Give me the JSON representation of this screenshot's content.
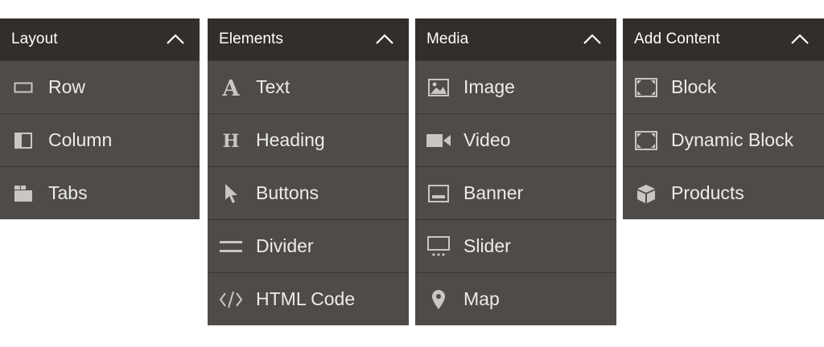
{
  "panels": {
    "layout": {
      "title": "Layout",
      "items": [
        {
          "label": "Row",
          "icon": "row-icon"
        },
        {
          "label": "Column",
          "icon": "column-icon"
        },
        {
          "label": "Tabs",
          "icon": "tabs-icon"
        }
      ]
    },
    "elements": {
      "title": "Elements",
      "items": [
        {
          "label": "Text",
          "icon": "text-icon"
        },
        {
          "label": "Heading",
          "icon": "heading-icon"
        },
        {
          "label": "Buttons",
          "icon": "pointer-icon"
        },
        {
          "label": "Divider",
          "icon": "divider-icon"
        },
        {
          "label": "HTML Code",
          "icon": "code-icon"
        }
      ]
    },
    "media": {
      "title": "Media",
      "items": [
        {
          "label": "Image",
          "icon": "image-icon"
        },
        {
          "label": "Video",
          "icon": "video-icon"
        },
        {
          "label": "Banner",
          "icon": "banner-icon"
        },
        {
          "label": "Slider",
          "icon": "slider-icon"
        },
        {
          "label": "Map",
          "icon": "map-pin-icon"
        }
      ]
    },
    "add_content": {
      "title": "Add Content",
      "items": [
        {
          "label": "Block",
          "icon": "block-icon"
        },
        {
          "label": "Dynamic Block",
          "icon": "dynamic-block-icon"
        },
        {
          "label": "Products",
          "icon": "products-icon"
        }
      ]
    }
  },
  "colors": {
    "header_bg": "#332e2c",
    "panel_bg": "#4f4b48",
    "icon": "#c9c6c4",
    "text": "#ececec"
  }
}
